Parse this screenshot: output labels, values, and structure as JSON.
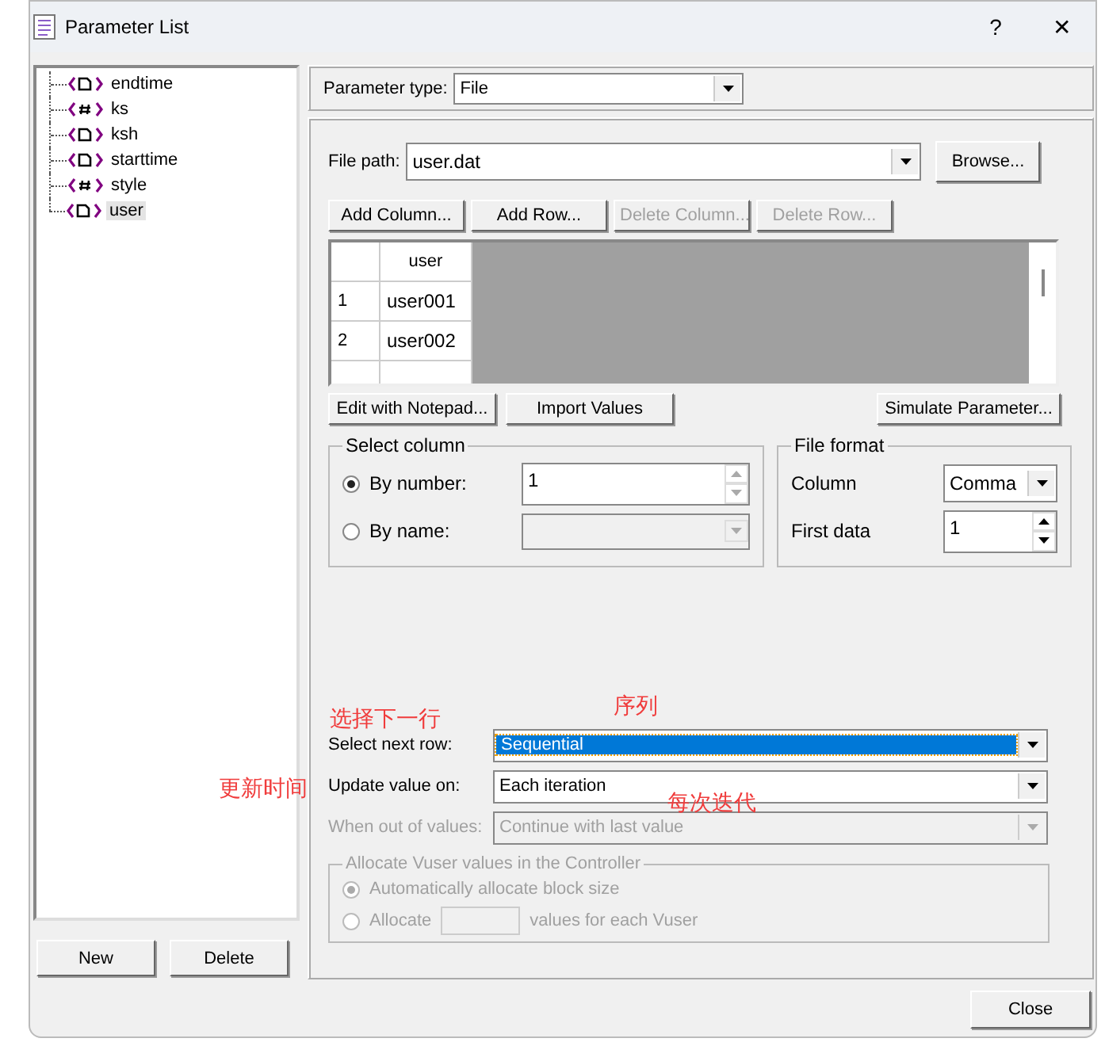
{
  "window": {
    "title": "Parameter List",
    "help": "?",
    "close": "✕"
  },
  "tree": [
    {
      "name": "endtime",
      "kind": "file",
      "selected": false
    },
    {
      "name": "ks",
      "kind": "number",
      "selected": false
    },
    {
      "name": "ksh",
      "kind": "file",
      "selected": false
    },
    {
      "name": "starttime",
      "kind": "file",
      "selected": false
    },
    {
      "name": "style",
      "kind": "number",
      "selected": false
    },
    {
      "name": "user",
      "kind": "file",
      "selected": true
    }
  ],
  "tree_buttons": [
    "New",
    "Delete"
  ],
  "parameter_type": {
    "label": "Parameter type:",
    "value": "File"
  },
  "file_path": {
    "label": "File path:",
    "value": "user.dat",
    "button": "Browse..."
  },
  "table_buttons": [
    {
      "label": "Add Column...",
      "disabled": false
    },
    {
      "label": "Add Row...",
      "disabled": false
    },
    {
      "label": "Delete Column...",
      "disabled": true
    },
    {
      "label": "Delete Row...",
      "disabled": true
    }
  ],
  "table": {
    "columns": [
      "user"
    ],
    "rows": [
      {
        "number": "1",
        "user": "user001"
      },
      {
        "number": "2",
        "user": "user002"
      }
    ]
  },
  "data_buttons": [
    "Edit with Notepad...",
    "Import Values",
    "Simulate Parameter..."
  ],
  "select_column": {
    "title": "Select column",
    "options": [
      {
        "label": "By number:",
        "selected": true,
        "value": "1",
        "disabled": false
      },
      {
        "label": "By name:",
        "selected": false,
        "disabled": true
      }
    ]
  },
  "file_format": {
    "title": "File format",
    "column_label": "Column",
    "column_value": "Comma",
    "first_data_label": "First data",
    "first_data_value": "1"
  },
  "settings": [
    {
      "label": "Select next row:",
      "value": "Sequential",
      "highlighted": true,
      "disabled": false
    },
    {
      "label": "Update value on:",
      "value": "Each iteration",
      "highlighted": false,
      "disabled": false
    },
    {
      "label": "When out of values:",
      "value": "Continue with last value",
      "highlighted": false,
      "disabled": true
    }
  ],
  "allocate": {
    "title": "Allocate Vuser values in the Controller",
    "disabled": true,
    "options": [
      {
        "label": "Automatically allocate block size",
        "selected": true
      },
      {
        "label": "Allocate",
        "selected": false,
        "suffix": "values for each Vuser"
      }
    ]
  },
  "annotations": [
    {
      "text": "选择下一行"
    },
    {
      "text": "序列"
    },
    {
      "text": "更新时间"
    },
    {
      "text": "每次迭代"
    }
  ],
  "close_button": "Close"
}
